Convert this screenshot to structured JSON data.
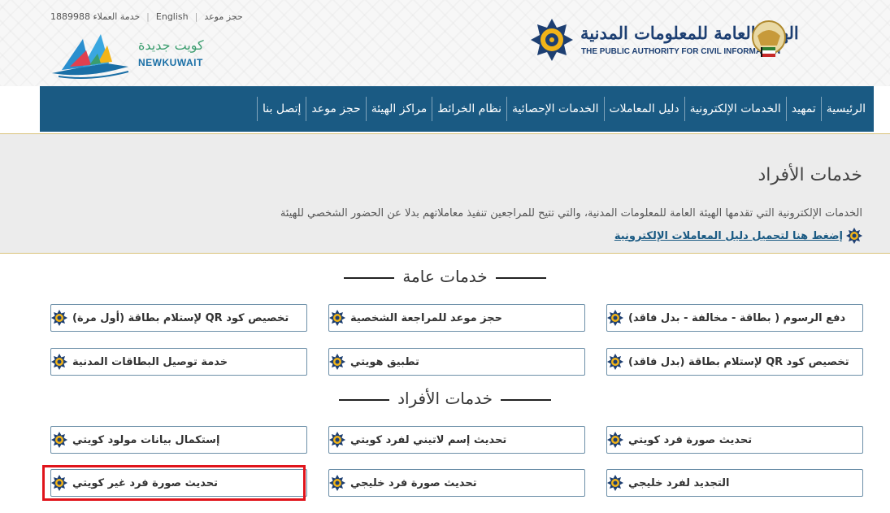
{
  "toplinks": {
    "book": "حجز موعد",
    "lang": "English",
    "hotline": "خدمة العملاء 1889988"
  },
  "brand": {
    "newkuwait_ar": "كويت جديدة",
    "newkuwait_en": "NEWKUWAIT",
    "paci_ar": "الهيئة العامة للمعلومات المدنية",
    "paci_en": "THE PUBLIC AUTHORITY FOR CIVIL INFORMATION"
  },
  "nav": [
    "الرئيسية",
    "تمهيد",
    "الخدمات الإلكترونية",
    "دليل المعاملات",
    "الخدمات الإحصائية",
    "نظام الخرائط",
    "مراكز الهيئة",
    "حجز موعد",
    "إتصل بنا"
  ],
  "intro": {
    "title": "خدمات الأفراد",
    "description": "الخدمات الإلكترونية التي تقدمها الهيئة العامة للمعلومات المدنية، والتي تتيح للمراجعين تنفيذ معاملاتهم بدلا عن الحضور الشخصي للهيئة",
    "link": "إضغط هنا لتحميل دليل المعاملات الإلكترونية"
  },
  "general": {
    "title": "خدمات عامة",
    "items": [
      "دفع الرسوم ( بطاقة - مخالفة - بدل فاقد)",
      "حجز موعد للمراجعة الشخصية",
      "تخصيص كود QR لإستلام بطاقة (أول مرة)",
      "تخصيص كود QR لإستلام بطاقة (بدل فاقد)",
      "تطبيق هويتي",
      "خدمة توصيل البطاقات المدنية"
    ]
  },
  "individuals": {
    "title": "خدمات الأفراد",
    "items": [
      "تحديث صورة فرد كويتي",
      "تحديث إسم لاتيني لفرد كويتي",
      "إستكمال بيانات مولود كويتي",
      "التجديد لفرد خليجي",
      "تحديث صورة فرد خليجي",
      "تحديث صورة فرد غير كويتي"
    ]
  },
  "colors": {
    "nav_bg": "#1a5a83",
    "highlight": "#e0141b",
    "border": "#6c8fa8"
  }
}
